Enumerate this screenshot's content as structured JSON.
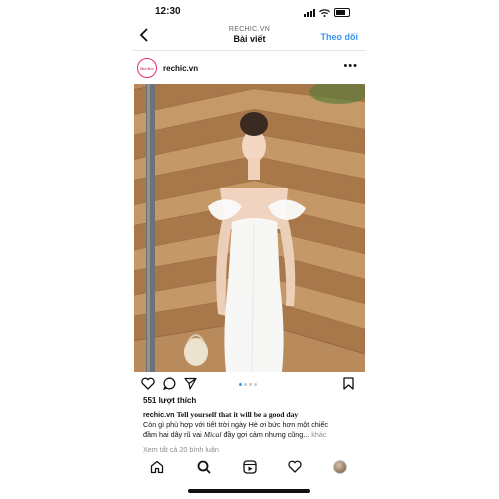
{
  "status": {
    "time": "12:30"
  },
  "header": {
    "account": "RECHIC.VN",
    "title": "Bài viết",
    "follow_label": "Theo dõi",
    "back_icon": "chevron-left-icon"
  },
  "post": {
    "avatar_text": "Rechic",
    "username": "rechic.vn",
    "more_icon": "ellipsis-icon",
    "photo_alt": "post-photo",
    "carousel": {
      "count": 4,
      "active": 1
    },
    "likes": "551 lượt thích",
    "caption": {
      "username": "rechic.vn",
      "headline": "Tell yourself that it will be a good day",
      "line2": "Còn gì phù hợp với tiết trời ngày Hè ơi bức hơn một chiếc",
      "line3_prefix": "đầm hai dây rũ vai ",
      "brand": "Mical",
      "line3_suffix": " đầy gợi cảm nhưng cũng...",
      "more_label": "khác"
    },
    "comments_link": "Xem tất cả 20 bình luận"
  },
  "tabbar": {
    "items": [
      "home-icon",
      "search-icon",
      "reels-icon",
      "heart-icon",
      "profile-avatar"
    ]
  }
}
